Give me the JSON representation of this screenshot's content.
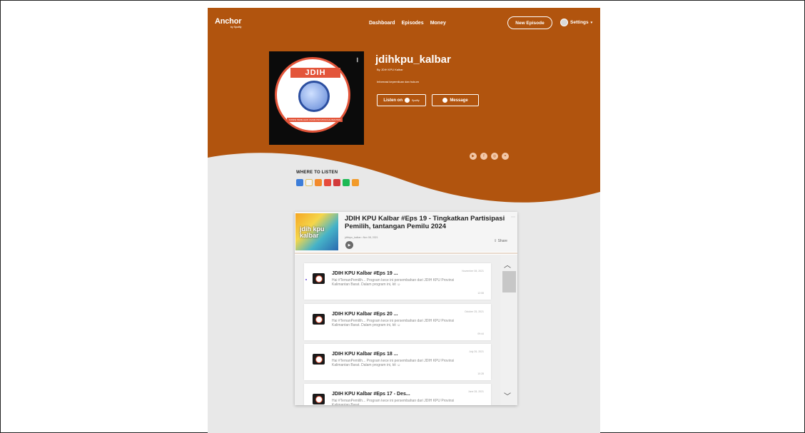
{
  "header": {
    "logo": "Anchor",
    "logo_by": "by Spotify",
    "nav": [
      "Dashboard",
      "Episodes",
      "Money"
    ],
    "new_episode": "New Episode",
    "settings": "Settings",
    "brand_color": "#b1540e"
  },
  "podcast": {
    "title": "jdihkpu_kalbar",
    "by": "By JDIH KPU Kalbar",
    "description": "Informasi kepemiluan dan hukum",
    "cover_text": "JDIH",
    "cover_caption": "KOMISI PEMILIHAN UMUM PROVINSI KALIMANTAN BARAT",
    "listen_on": "Listen on",
    "spotify": "Spotify",
    "message": "Message"
  },
  "where_to_listen": {
    "label": "WHERE TO LISTEN",
    "platforms": [
      "breaker-icon",
      "google-podcasts-icon",
      "overcast-icon",
      "pocket-casts-icon",
      "radiopublic-icon",
      "spotify-icon",
      "rss-icon"
    ]
  },
  "featured": {
    "title": "JDIH KPU Kalbar #Eps 19 - Tingkatkan Partisipasi Pemilih, tantangan Pemilu 2024",
    "meta": "jdihkpu_kalbar • Nov 08, 2021",
    "thumb_text": "jdih kpu kalbar",
    "share": "Share"
  },
  "episodes": [
    {
      "title": "JDIH KPU Kalbar #Eps 19 ...",
      "desc": "Hai #TemanPemilih... Program kece ini persembahan dari JDIH KPU Provinsi Kalimantan Barat. Dalam program ini, kit ☺",
      "date": "November 08, 2021",
      "duration": "12:08"
    },
    {
      "title": "JDIH KPU Kalbar #Eps 20 ...",
      "desc": "Hai #TemanPemilih... Program kece ini persembahan dari JDIH KPU Provinsi Kalimantan Barat. Dalam program ini, kit ☺",
      "date": "October 25, 2021",
      "duration": "09:44"
    },
    {
      "title": "JDIH KPU Kalbar #Eps 18 ...",
      "desc": "Hai #TemanPemilih... Program kece ini persembahan dari JDIH KPU Provinsi Kalimantan Barat. Dalam program ini, kit ☺",
      "date": "July 26, 2021",
      "duration": "10:28"
    },
    {
      "title": "JDIH KPU Kalbar #Eps 17 - Des...",
      "desc": "Hai #TemanPemilih... Program kece ini persembahan dari JDIH KPU Provinsi Kalimantan Barat.",
      "date": "June 28, 2021",
      "duration": ""
    }
  ]
}
